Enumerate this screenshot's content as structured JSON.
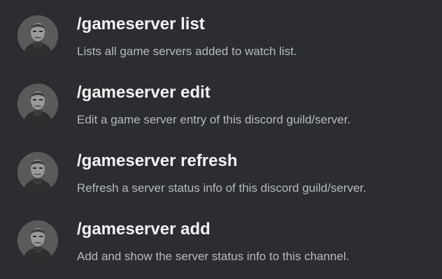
{
  "commands": [
    {
      "name": "/gameserver list",
      "description": "Lists all game servers added to watch list.",
      "icon": "bot-avatar"
    },
    {
      "name": "/gameserver edit",
      "description": "Edit a game server entry of this discord guild/server.",
      "icon": "bot-avatar"
    },
    {
      "name": "/gameserver refresh",
      "description": "Refresh a server status info of this discord guild/server.",
      "icon": "bot-avatar"
    },
    {
      "name": "/gameserver add",
      "description": "Add and show the server status info to this channel.",
      "icon": "bot-avatar"
    }
  ]
}
